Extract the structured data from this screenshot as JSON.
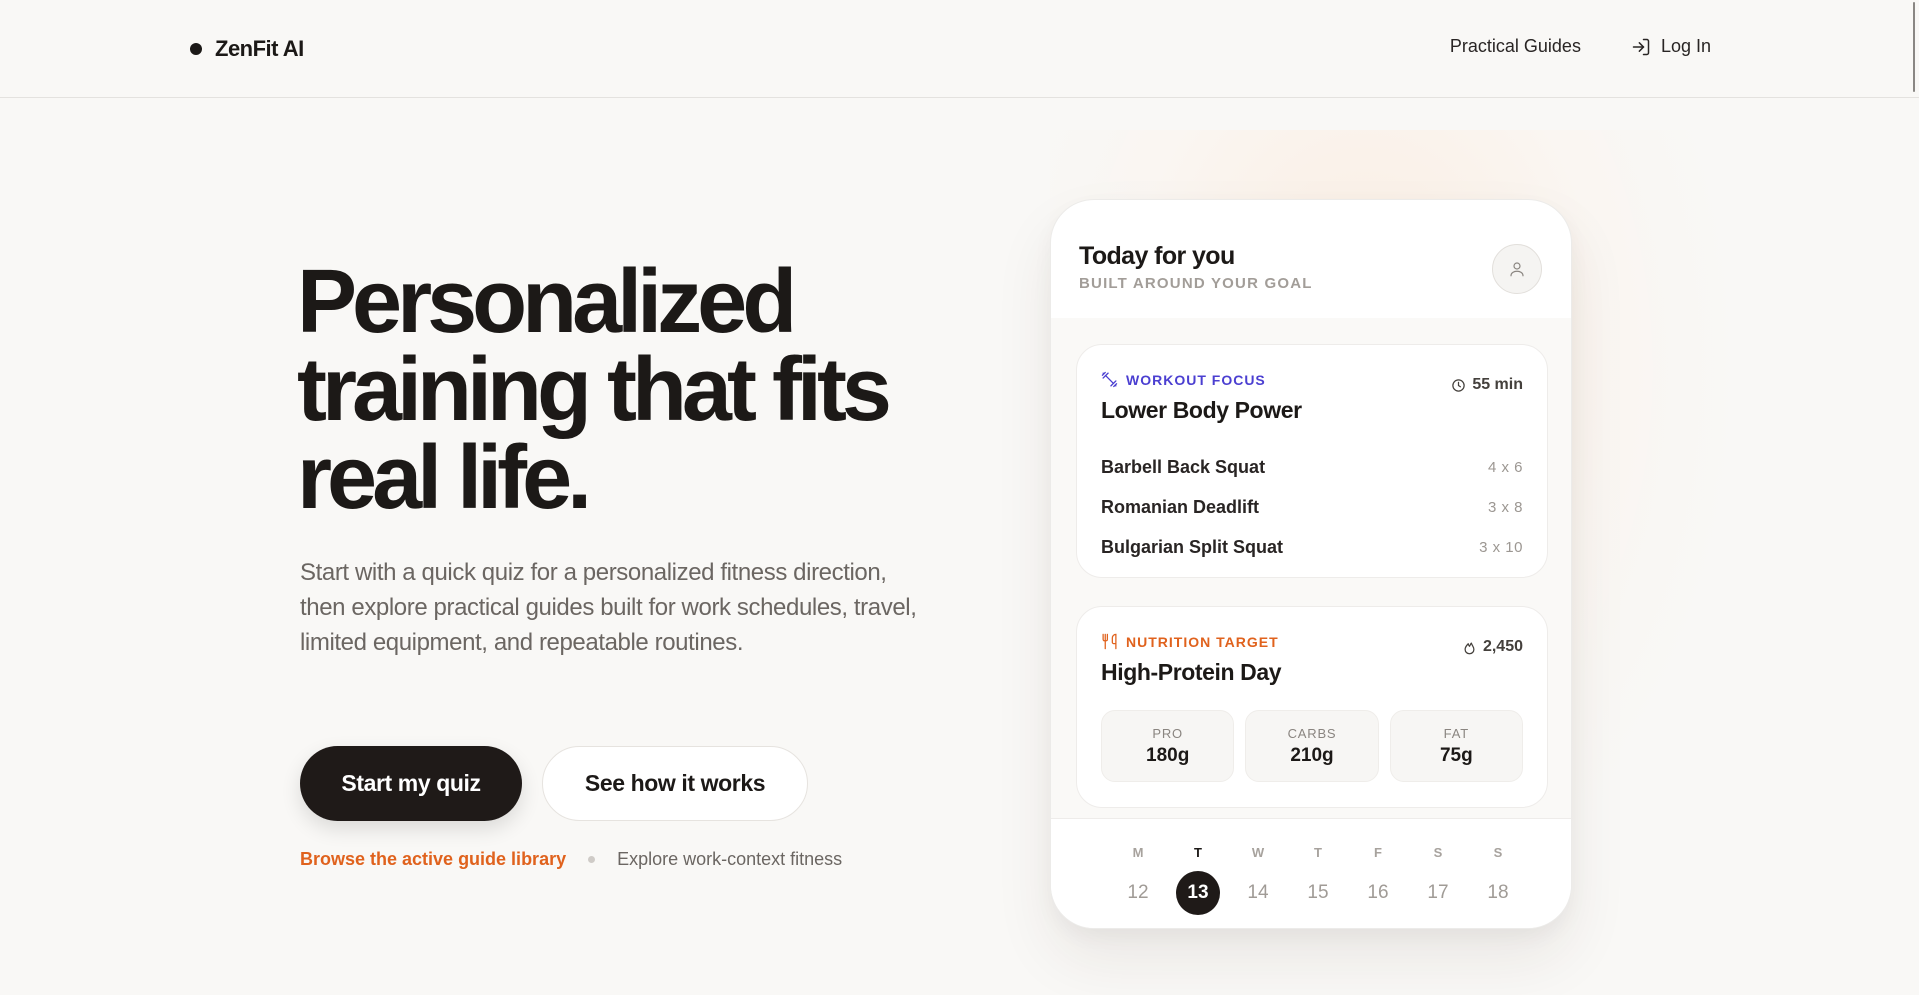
{
  "brand": {
    "name": "ZenFit AI"
  },
  "nav": {
    "guides_label": "Practical Guides",
    "login_label": "Log In"
  },
  "hero": {
    "title_line1": "Personalized",
    "title_line2": "training that fits",
    "title_line3": "real life.",
    "subtitle": "Start with a quick quiz for a personalized fitness direction, then explore practical guides built for work schedules, travel, limited equipment, and repeatable routines.",
    "primary_cta": "Start my quiz",
    "secondary_cta": "See how it works",
    "link_primary": "Browse the active guide library",
    "link_secondary": "Explore work-context fitness"
  },
  "preview": {
    "title": "Today for you",
    "subtitle": "BUILT AROUND YOUR GOAL",
    "workout": {
      "kicker": "WORKOUT FOCUS",
      "duration": "55 min",
      "title": "Lower Body Power",
      "exercises": [
        {
          "name": "Barbell Back Squat",
          "reps": "4 x 6"
        },
        {
          "name": "Romanian Deadlift",
          "reps": "3 x 8"
        },
        {
          "name": "Bulgarian Split Squat",
          "reps": "3 x 10"
        }
      ]
    },
    "nutrition": {
      "kicker": "NUTRITION TARGET",
      "calories": "2,450",
      "title": "High-Protein Day",
      "macros": [
        {
          "label": "PRO",
          "value": "180g"
        },
        {
          "label": "CARBS",
          "value": "210g"
        },
        {
          "label": "FAT",
          "value": "75g"
        }
      ]
    },
    "week": [
      {
        "label": "M",
        "date": "12"
      },
      {
        "label": "T",
        "date": "13"
      },
      {
        "label": "W",
        "date": "14"
      },
      {
        "label": "T",
        "date": "15"
      },
      {
        "label": "F",
        "date": "16"
      },
      {
        "label": "S",
        "date": "17"
      },
      {
        "label": "S",
        "date": "18"
      }
    ],
    "active_day_index": 1
  },
  "colors": {
    "accent_orange": "#e0621d",
    "accent_indigo": "#4b3fd1",
    "ink": "#1c1917"
  }
}
